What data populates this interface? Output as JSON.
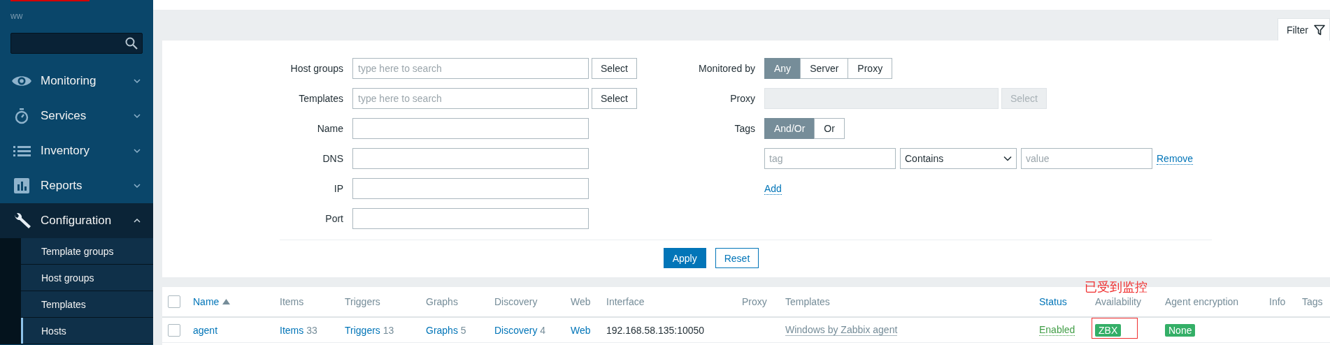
{
  "sidebar": {
    "brand_text": "ww",
    "menu": [
      {
        "label": "Monitoring",
        "expanded": false
      },
      {
        "label": "Services",
        "expanded": false
      },
      {
        "label": "Inventory",
        "expanded": false
      },
      {
        "label": "Reports",
        "expanded": false
      },
      {
        "label": "Configuration",
        "expanded": true,
        "children": [
          {
            "label": "Template groups",
            "selected": false
          },
          {
            "label": "Host groups",
            "selected": false
          },
          {
            "label": "Templates",
            "selected": false
          },
          {
            "label": "Hosts",
            "selected": true
          }
        ]
      }
    ]
  },
  "filter": {
    "tab_label": "Filter",
    "left_fields": [
      {
        "label": "Host groups",
        "kind": "multiselect",
        "placeholder": "type here to search",
        "button": "Select"
      },
      {
        "label": "Templates",
        "kind": "multiselect",
        "placeholder": "type here to search",
        "button": "Select"
      },
      {
        "label": "Name",
        "kind": "text"
      },
      {
        "label": "DNS",
        "kind": "text"
      },
      {
        "label": "IP",
        "kind": "text"
      },
      {
        "label": "Port",
        "kind": "text"
      }
    ],
    "monitored_by": {
      "label": "Monitored by",
      "options": [
        {
          "label": "Any",
          "selected": true
        },
        {
          "label": "Server",
          "selected": false
        },
        {
          "label": "Proxy",
          "selected": false
        }
      ]
    },
    "proxy": {
      "label": "Proxy",
      "disabled": true,
      "button": "Select"
    },
    "tags": {
      "label": "Tags",
      "options": [
        {
          "label": "And/Or",
          "selected": true
        },
        {
          "label": "Or",
          "selected": false
        }
      ],
      "rows": [
        {
          "tag_placeholder": "tag",
          "operator": "Contains",
          "value_placeholder": "value",
          "remove": "Remove"
        }
      ],
      "add": "Add"
    },
    "apply": "Apply",
    "reset": "Reset"
  },
  "table": {
    "columns": [
      {
        "kind": "checkbox",
        "checked": false
      },
      {
        "label": "Name",
        "kind": "sortable",
        "sorted": true
      },
      {
        "label": "Items",
        "kind": "plain"
      },
      {
        "label": "Triggers",
        "kind": "plain"
      },
      {
        "label": "Graphs",
        "kind": "plain"
      },
      {
        "label": "Discovery",
        "kind": "plain"
      },
      {
        "label": "Web",
        "kind": "plain"
      },
      {
        "label": "Interface",
        "kind": "plain"
      },
      {
        "label": "Proxy",
        "kind": "plain"
      },
      {
        "label": "Templates",
        "kind": "plain"
      },
      {
        "label": "Status",
        "kind": "sortable",
        "sorted": false
      },
      {
        "label": "Availability",
        "kind": "plain"
      },
      {
        "label": "Agent encryption",
        "kind": "plain"
      },
      {
        "label": "Info",
        "kind": "plain"
      },
      {
        "label": "Tags",
        "kind": "plain"
      }
    ],
    "rows": [
      {
        "checked": false,
        "cells": [
          {
            "kind": "checkbox"
          },
          {
            "kind": "link",
            "text": "agent"
          },
          {
            "kind": "link_count",
            "text": "Items",
            "count": "33"
          },
          {
            "kind": "link_count",
            "text": "Triggers",
            "count": "13"
          },
          {
            "kind": "link_count",
            "text": "Graphs",
            "count": "5"
          },
          {
            "kind": "link_count",
            "text": "Discovery",
            "count": "4"
          },
          {
            "kind": "link",
            "text": "Web"
          },
          {
            "kind": "text",
            "text": "192.168.58.135:10050"
          },
          {
            "kind": "empty"
          },
          {
            "kind": "template",
            "text": "Windows by Zabbix agent"
          },
          {
            "kind": "status",
            "text": "Enabled",
            "enabled": true
          },
          {
            "kind": "badge",
            "text": "ZBX",
            "color": "#34af67",
            "annotated": true
          },
          {
            "kind": "badge",
            "text": "None",
            "color": "#34af67"
          },
          {
            "kind": "empty"
          },
          {
            "kind": "empty"
          }
        ]
      }
    ]
  },
  "annotation": {
    "text": "已受到监控"
  }
}
